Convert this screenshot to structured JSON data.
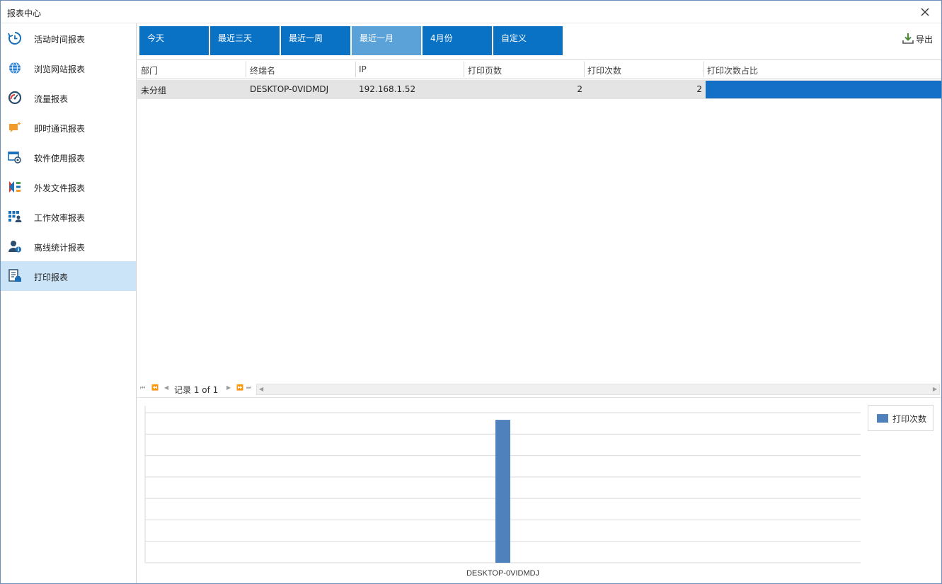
{
  "window": {
    "title": "报表中心"
  },
  "sidebar": {
    "items": [
      {
        "label": "活动时间报表",
        "icon": "clock-history-icon"
      },
      {
        "label": "浏览网站报表",
        "icon": "globe-icon"
      },
      {
        "label": "流量报表",
        "icon": "speedometer-icon"
      },
      {
        "label": "即时通讯报表",
        "icon": "chat-bubble-icon"
      },
      {
        "label": "软件使用报表",
        "icon": "software-window-icon"
      },
      {
        "label": "外发文件报表",
        "icon": "file-share-icon"
      },
      {
        "label": "工作效率报表",
        "icon": "efficiency-grid-icon"
      },
      {
        "label": "离线统计报表",
        "icon": "user-info-icon"
      },
      {
        "label": "打印报表",
        "icon": "print-document-icon"
      }
    ],
    "active_index": 8
  },
  "tabs": {
    "items": [
      "今天",
      "最近三天",
      "最近一周",
      "最近一月",
      "4月份",
      "自定义"
    ],
    "active_index": 3
  },
  "toolbar": {
    "export_label": "导出"
  },
  "grid": {
    "columns": [
      "部门",
      "终端名",
      "IP",
      "打印页数",
      "打印次数",
      "打印次数占比"
    ],
    "rows": [
      {
        "dept": "未分组",
        "terminal": "DESKTOP-0VIDMDJ",
        "ip": "192.168.1.52",
        "pages": "2",
        "count": "2",
        "share": 1.0
      }
    ]
  },
  "pager": {
    "text": "记录 1 of 1"
  },
  "colors": {
    "accent": "#0a72c5",
    "tab_active": "#5aa2d8",
    "bar": "#4f81bd",
    "row_bar": "#1470c6"
  },
  "chart_data": {
    "type": "bar",
    "categories": [
      "DESKTOP-0VIDMDJ"
    ],
    "series": [
      {
        "name": "打印次数",
        "values": [
          2
        ]
      }
    ],
    "ylim": [
      0,
      2.1
    ],
    "grid": true,
    "legend": "top-right"
  }
}
